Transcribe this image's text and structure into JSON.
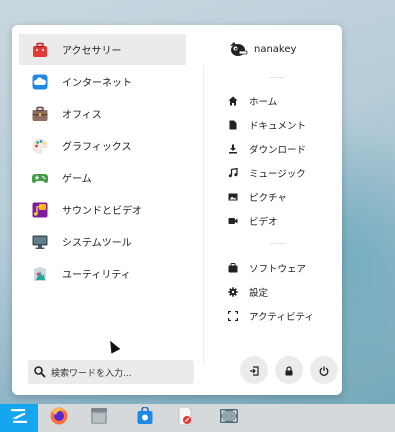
{
  "categories": [
    {
      "label": "アクセサリー",
      "icon": "accessories-icon"
    },
    {
      "label": "インターネット",
      "icon": "internet-icon"
    },
    {
      "label": "オフィス",
      "icon": "office-icon"
    },
    {
      "label": "グラフィックス",
      "icon": "graphics-icon"
    },
    {
      "label": "ゲーム",
      "icon": "games-icon"
    },
    {
      "label": "サウンドとビデオ",
      "icon": "sound-video-icon"
    },
    {
      "label": "システムツール",
      "icon": "system-tools-icon"
    },
    {
      "label": "ユーティリティ",
      "icon": "utilities-icon"
    }
  ],
  "search": {
    "placeholder": "検索ワードを入力..."
  },
  "user": {
    "name": "nanakey"
  },
  "places": [
    {
      "label": "ホーム",
      "icon": "home-icon"
    },
    {
      "label": "ドキュメント",
      "icon": "document-icon"
    },
    {
      "label": "ダウンロード",
      "icon": "download-icon"
    },
    {
      "label": "ミュージック",
      "icon": "music-icon"
    },
    {
      "label": "ピクチャ",
      "icon": "picture-icon"
    },
    {
      "label": "ビデオ",
      "icon": "video-icon"
    }
  ],
  "system": [
    {
      "label": "ソフトウェア",
      "icon": "software-icon"
    },
    {
      "label": "設定",
      "icon": "settings-icon"
    },
    {
      "label": "アクティビティ",
      "icon": "activity-icon"
    }
  ],
  "power_buttons": [
    "logout-icon",
    "lock-icon",
    "power-icon"
  ],
  "taskbar": [
    "zorin-menu-icon",
    "firefox-icon",
    "files-icon",
    "software-store-icon",
    "text-editor-icon",
    "screenshot-icon"
  ],
  "colors": {
    "accent": "#15a6f0",
    "active_row": "#ebebeb",
    "taskbar": "#d6d9dc"
  }
}
